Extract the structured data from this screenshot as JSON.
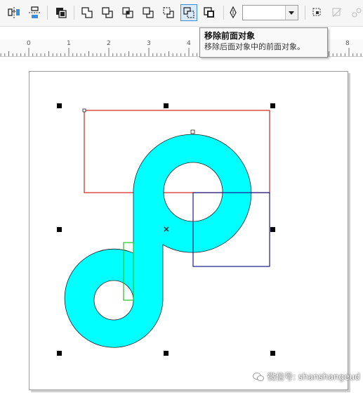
{
  "toolbar": {
    "buttons": [
      {
        "name": "mirror-horizontal-button",
        "icon": "mirror-horizontal-icon"
      },
      {
        "name": "mirror-vertical-button",
        "icon": "mirror-vertical-icon"
      },
      {
        "name": "order-button",
        "icon": "order-icon"
      },
      {
        "name": "weld-button",
        "icon": "weld-icon"
      },
      {
        "name": "trim-button",
        "icon": "trim-icon"
      },
      {
        "name": "intersect-button",
        "icon": "intersect-icon"
      },
      {
        "name": "simplify-button",
        "icon": "simplify-icon"
      },
      {
        "name": "front-minus-back-button",
        "icon": "front-minus-back-icon"
      },
      {
        "name": "back-minus-front-button",
        "icon": "back-minus-front-icon",
        "active": true
      },
      {
        "name": "create-boundary-button",
        "icon": "boundary-icon"
      }
    ],
    "outline_width": {
      "value": ""
    },
    "accent_color": "#3c8ede"
  },
  "tooltip": {
    "title": "移除前面对象",
    "description": "移除后面对象中的前面对象。"
  },
  "ruler": {
    "labels": [
      "0",
      "1",
      "2",
      "3",
      "4",
      "7",
      "8"
    ]
  },
  "canvas": {
    "colors": {
      "shape_fill": "#00ffff",
      "red_rect": "#d42020",
      "blue_rect": "#1a1a8c",
      "green_rect": "#22c322"
    }
  },
  "watermark": {
    "text": "微信号: shanshangeud"
  }
}
